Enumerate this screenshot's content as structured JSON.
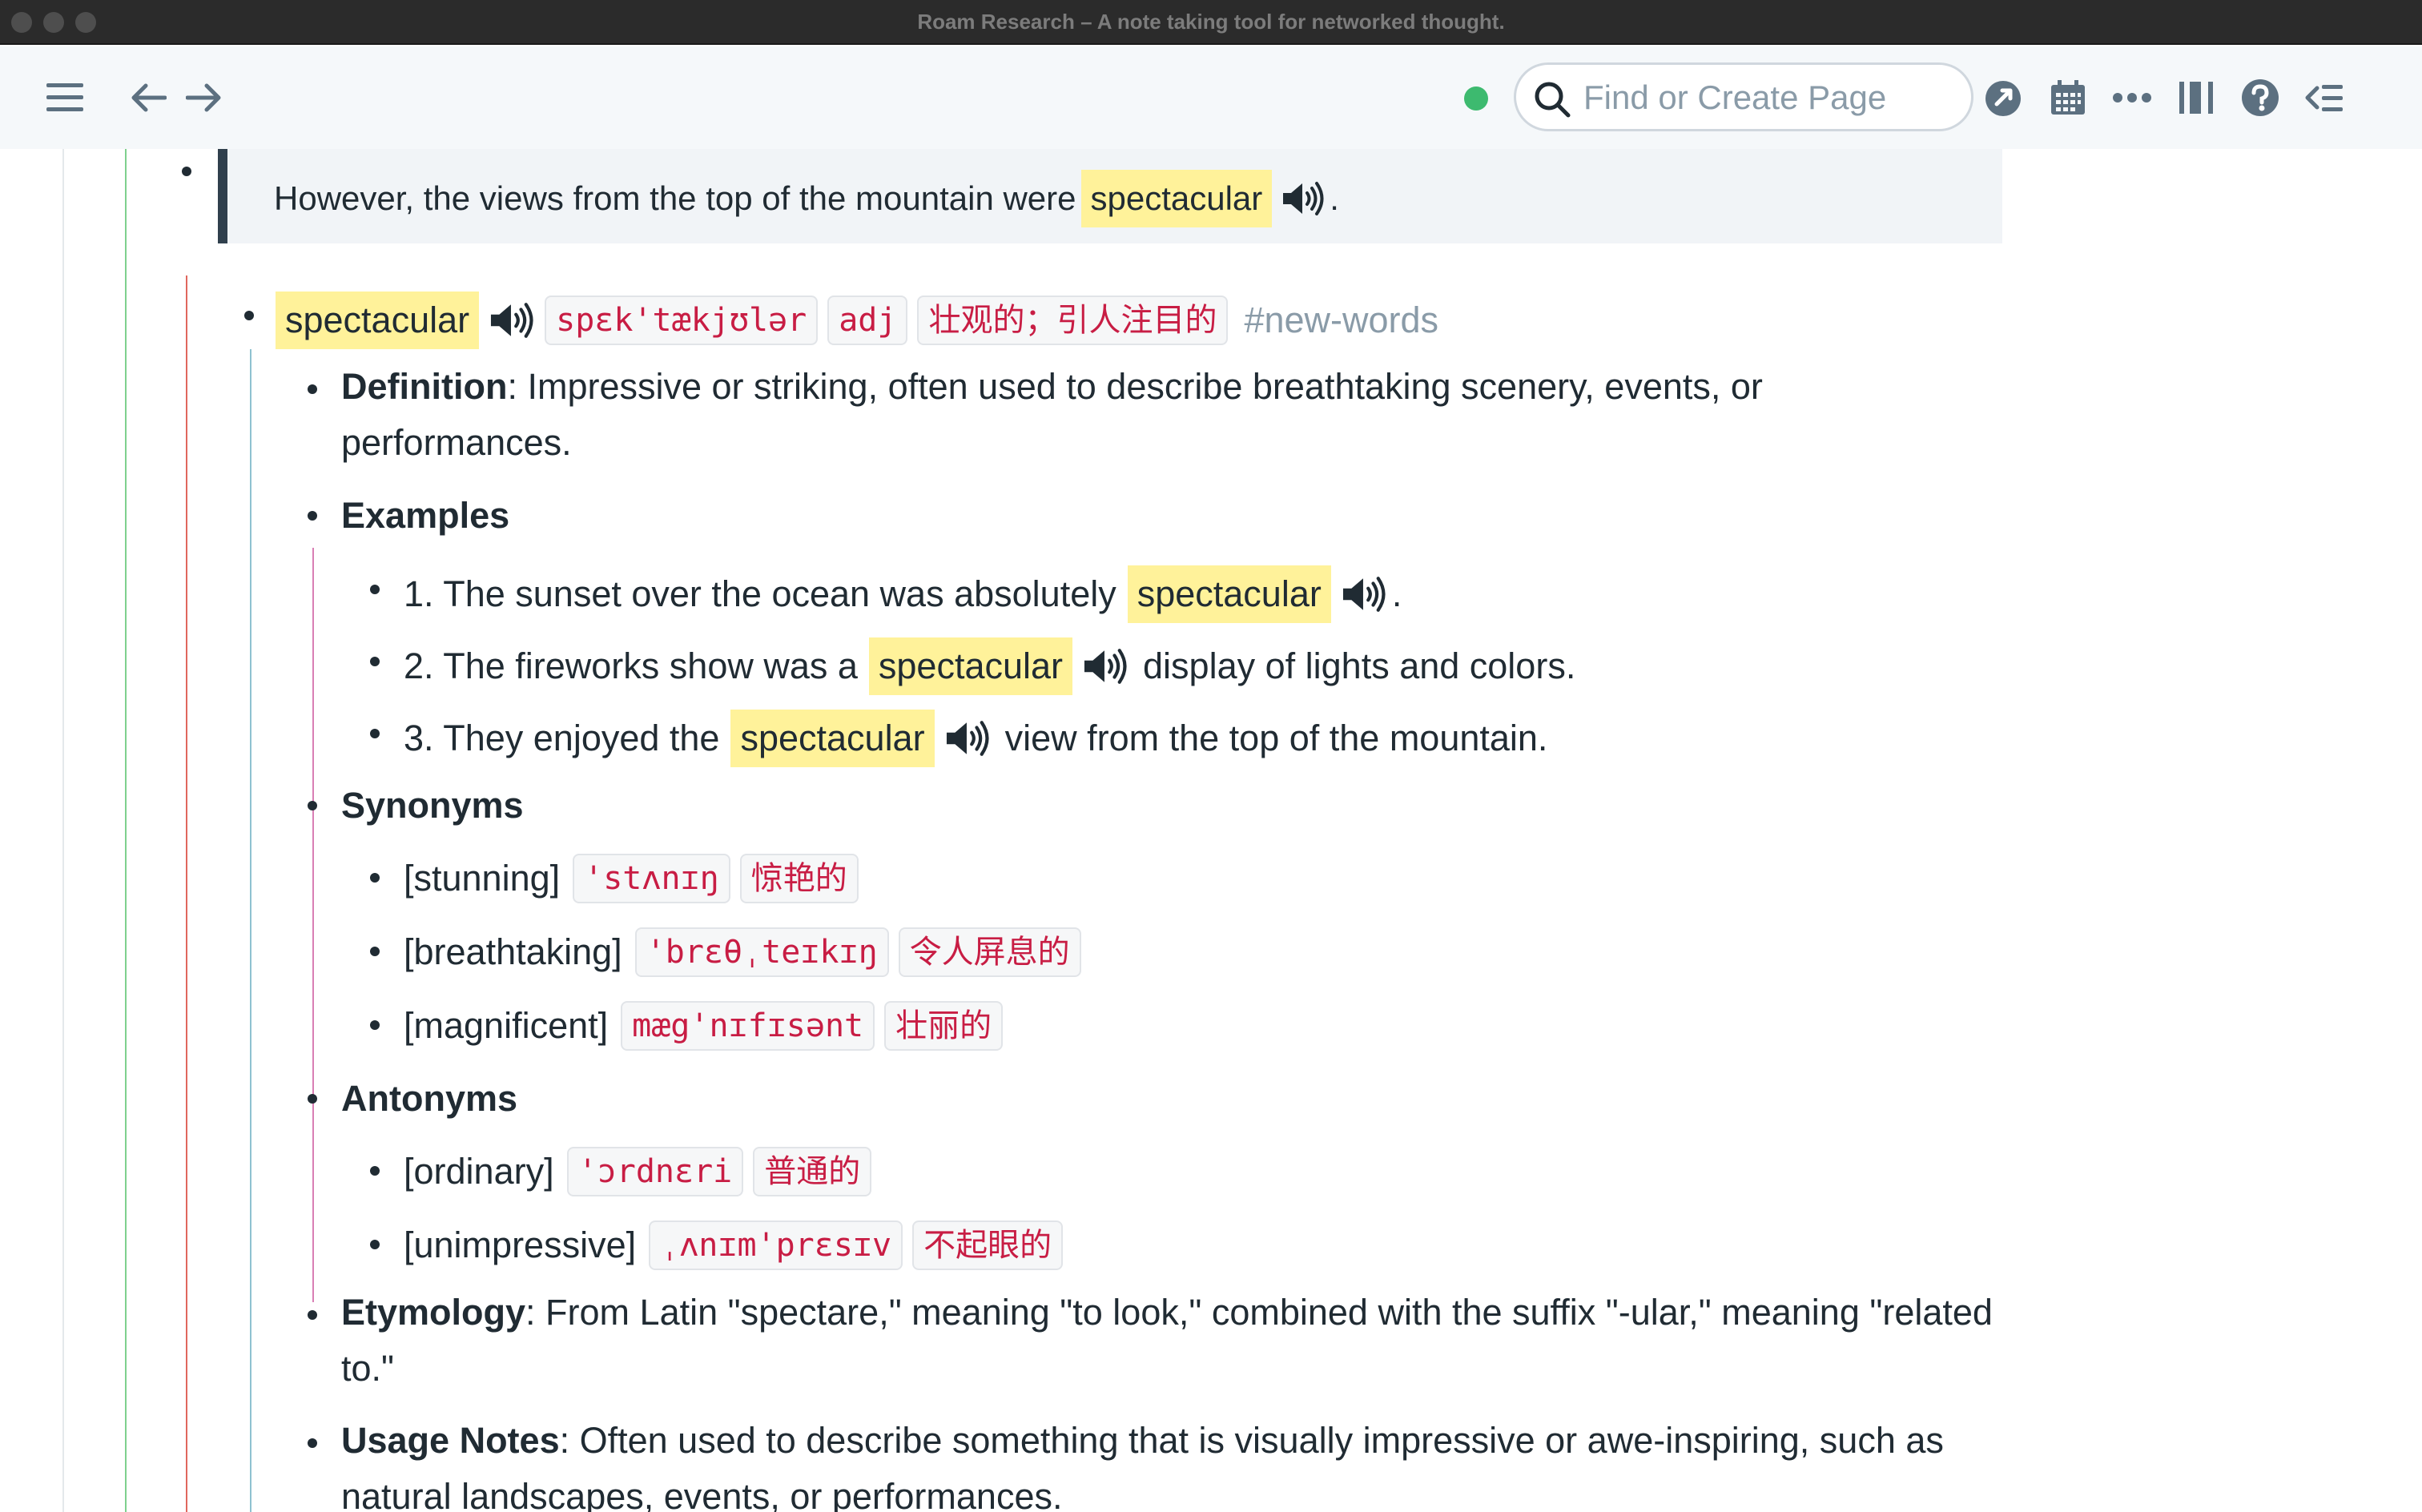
{
  "window": {
    "title": "Roam Research – A note taking tool for networked thought."
  },
  "topbar": {
    "search_placeholder": "Find or Create Page",
    "icons": [
      "menu-icon",
      "back-arrow-icon",
      "forward-arrow-icon",
      "sync-status-dot",
      "search-icon",
      "graph-icon",
      "calendar-icon",
      "more-icon",
      "sidebar-icon",
      "help-icon",
      "right-sidebar-icon"
    ],
    "status_color": "#3dba6f"
  },
  "quote": {
    "text": "However, the views from the top of the mountain were",
    "word": "spectacular",
    "after": "."
  },
  "entry": {
    "word": "spectacular",
    "ipa": "spɛk'tækjʊlər",
    "pos": "adj",
    "chinese": "壮观的；引人注目的",
    "tag": "#new-words"
  },
  "definition": {
    "label": "Definition",
    "text": ": Impressive or striking, often used to describe breathtaking scenery, events, or performances."
  },
  "examples": {
    "label": "Examples",
    "items": [
      {
        "before": "1. The sunset over the ocean was absolutely",
        "word": "spectacular",
        "after": "."
      },
      {
        "before": "2. The fireworks show was a",
        "word": "spectacular",
        "after": "display of lights and colors."
      },
      {
        "before": "3. They enjoyed the",
        "word": "spectacular",
        "after": "view from the top of the mountain."
      }
    ]
  },
  "synonyms": {
    "label": "Synonyms",
    "items": [
      {
        "word": "[stunning]",
        "ipa": "'stʌnɪŋ",
        "chinese": "惊艳的"
      },
      {
        "word": "[breathtaking]",
        "ipa": "'brɛθˌteɪkɪŋ",
        "chinese": "令人屏息的"
      },
      {
        "word": "[magnificent]",
        "ipa": "mæg'nɪfɪsənt",
        "chinese": "壮丽的"
      }
    ]
  },
  "antonyms": {
    "label": "Antonyms",
    "items": [
      {
        "word": "[ordinary]",
        "ipa": "'ɔrdnɛri",
        "chinese": "普通的"
      },
      {
        "word": "[unimpressive]",
        "ipa": "ˌʌnɪm'prɛsɪv",
        "chinese": "不起眼的"
      }
    ]
  },
  "etymology": {
    "label": "Etymology",
    "text": ": From Latin \"spectare,\" meaning \"to look,\" combined with the suffix \"-ular,\" meaning \"related to.\""
  },
  "usage": {
    "label": "Usage Notes",
    "text": ": Often used to describe something that is visually impressive or awe-inspiring, such as natural landscapes, events, or performances."
  }
}
